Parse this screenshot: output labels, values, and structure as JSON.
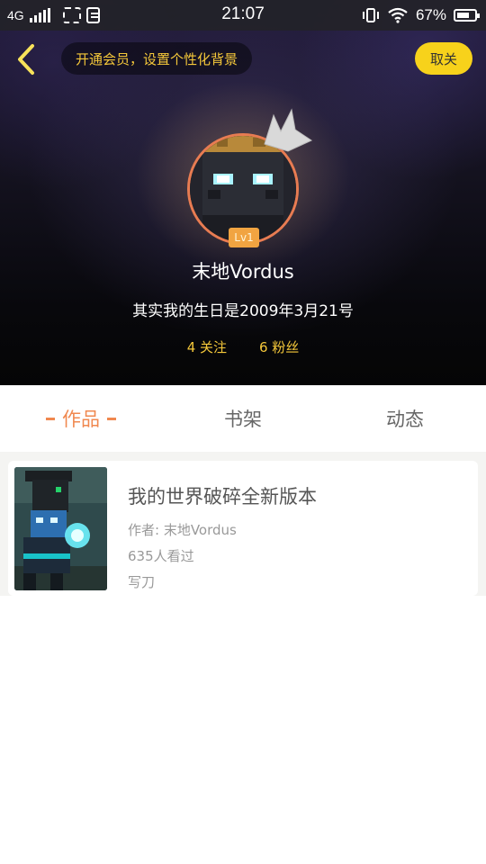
{
  "status_bar": {
    "network": "4G",
    "time": "21:07",
    "battery": "67%"
  },
  "header": {
    "vip_prompt": "开通会员，设置个性化背景",
    "follow_button": "取关",
    "level": "Lv1",
    "nickname": "末地Vordus",
    "bio": "其实我的生日是2009年3月21号",
    "following": "4 关注",
    "followers": "6 粉丝"
  },
  "tabs": [
    {
      "label": "作品",
      "active": true
    },
    {
      "label": "书架",
      "active": false
    },
    {
      "label": "动态",
      "active": false
    }
  ],
  "works": [
    {
      "title": "我的世界破碎全新版本",
      "author": "作者: 末地Vordus",
      "views": "635人看过",
      "tag": "写刀"
    }
  ],
  "colors": {
    "accent_orange": "#f0884f",
    "gold": "#f5c83a",
    "follow_yellow": "#f7d21b",
    "badge": "#f1a441"
  },
  "icons": [
    "back-arrow-icon",
    "signal-icon",
    "screenshot-icon",
    "sim-icon",
    "vibrate-icon",
    "wifi-icon",
    "battery-icon",
    "crown-icon"
  ]
}
